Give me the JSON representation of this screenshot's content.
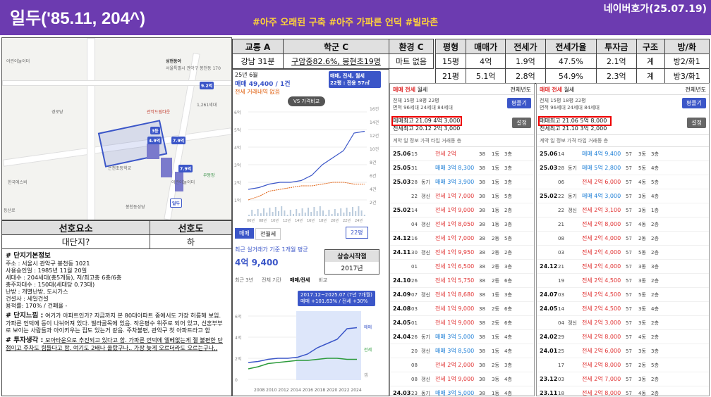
{
  "header": {
    "title": "일두('85.11, 204^)",
    "tags": "#아주 오래된 구축 #아주 가파른 언덕 #빌라촌",
    "source": "네이버호가(25.07.19)"
  },
  "summary_table": {
    "headers": [
      "교통 A",
      "학군 C",
      "환경 C"
    ],
    "values": [
      "강남 31분",
      "구암중82.6%, 봉현초19명",
      "마트 없음"
    ]
  },
  "type_table": {
    "headers": [
      "평형",
      "매매가",
      "전세가",
      "전세가율",
      "투자금",
      "구조",
      "방/화"
    ],
    "rows": [
      [
        "15평",
        "4억",
        "1.9억",
        "47.5%",
        "2.1억",
        "계",
        "방2/화1"
      ],
      [
        "21평",
        "5.1억",
        "2.8억",
        "54.9%",
        "2.3억",
        "계",
        "방3/화1"
      ]
    ]
  },
  "map": {
    "labels": [
      "어린이놀이터",
      "성현동아",
      "서울특별시 관악구 봉천동 170",
      "9.2억",
      "1,261세대",
      "관악드림타운",
      "3등",
      "8억",
      "4.9억",
      "7.9억",
      "5등",
      "7.9억",
      "은천초등학교",
      "어린이놀이터",
      "한국에스비",
      "우동장",
      "경로당",
      "봉천동성당",
      "어린이놀이터",
      "등산로",
      "일두"
    ]
  },
  "prefs": {
    "h1": "선호요소",
    "h2": "선호도",
    "v1": "대단지?",
    "v2": "하"
  },
  "memo": {
    "s1": "# 단지기본정보",
    "l1": "주소 : 서울시 관악구 봉천동 1021",
    "l2": "사용승인일 : 1985년 11월 20일",
    "l3": "세대수 : 204세대(총5개동), 저/최고층 6층/6층",
    "l4": "총주차대수 : 150대(세대당 0.73대)",
    "l5": "난방 : 개별난방, 도시가스",
    "l6": "건설사 : 세일건설",
    "l7": "용적률: 170% / 건폐율 -",
    "s2": "# 단지느낌 :",
    "p2": " 여기가 아파트인가? 지금까지 본 80대아파트 중에서도 가장 허름해 보임. 가파른 언덕에 동이 나뉘어져 있다. 빌라골목에 있음. 작은평수 위주로 되어 있고, 신혼부부로 보이는 사람들과 아이키우는 집도 있는거 같음. 주차불편, 관악구 첫 아파트라고 함",
    "s3": "# 투자생각 :",
    "p3": " 모아타운으로 추진되고 있다고 함. 가파른 언덕에 엘베없는게 젤 불편한 단점이고 주차도 힘들다고 함. 여기도 2배나 올랐구나.. 가장 늦게 오르더라도 오르는구나,,"
  },
  "chart": {
    "date": "25년 6월",
    "trade": "매매 49,400 / 1건",
    "rent": "전세 거래내역 없음",
    "vs": "VS 가격비교",
    "filter": "매매, 전세, 월세",
    "size": "22평 : 전용 57㎡",
    "yticks": [
      "6억",
      "5억",
      "4억",
      "3억",
      "2억",
      "1억"
    ],
    "yright": [
      "16건",
      "14건",
      "12건",
      "10건",
      "8건",
      "6건",
      "4건",
      "2건"
    ],
    "xticks": [
      "06년",
      "08년",
      "10년",
      "12년",
      "14년",
      "16년",
      "18년",
      "20년",
      "22년",
      "24년"
    ],
    "tab1": "매매",
    "tab2": "전월세",
    "sel": "22평",
    "recent": "최근 실거래가 기준 1개월 평균",
    "recentval": "4억 9,400",
    "risehead": "상승시작점",
    "riseyear": "2017년",
    "periods": [
      "최근 3년",
      "전체 기간",
      "매매/전세",
      "비교"
    ],
    "tooltip1": "2017.12~2025.07 (7년 7개월)",
    "tooltip2": "매매 +101.63% / 전세 +30%",
    "y2": [
      "6억",
      "4억",
      "2억",
      "0"
    ],
    "legend": [
      "매매",
      "전세",
      "갭"
    ],
    "x2": "2008 2010 2012 2014 2016 2018 2020 2022 2024",
    "chart_data": {
      "type": "line",
      "series": [
        {
          "name": "매매",
          "values": [
            1.6,
            1.7,
            1.9,
            2.0,
            2.0,
            2.1,
            2.4,
            3.0,
            3.4,
            3.8,
            4.8,
            4.9
          ]
        },
        {
          "name": "전세",
          "values": [
            1.0,
            1.2,
            1.5,
            1.6,
            1.7,
            1.8,
            1.8,
            1.9,
            2.0,
            2.0,
            1.9,
            1.9
          ]
        }
      ]
    }
  },
  "list1": {
    "tabs": [
      "매매",
      "전세",
      "월세"
    ],
    "year": "전체년도",
    "info": "전체 15평 18평 22평",
    "info2": "면적 96세대 24세대 84세대",
    "btn": "평플기",
    "max1": "매매최고 21.09 4억 3,000",
    "max2": "전세최고 20.12 2억 3,000",
    "set": "설정",
    "cols": "계약 일 정보 가격 타입 거래동 층",
    "rows": [
      [
        "25.06",
        "15",
        "",
        "전세 2억",
        "38",
        "1동",
        "3층"
      ],
      [
        "25.05",
        "31",
        "",
        "매매 3억 8,300",
        "38",
        "1동",
        "3층"
      ],
      [
        "25.03",
        "28",
        "동기",
        "매매 3억 3,900",
        "38",
        "1동",
        "3층"
      ],
      [
        "",
        "22",
        "갱신",
        "전세 1억 7,000",
        "38",
        "1동",
        "5층"
      ],
      [
        "25.02",
        "14",
        "",
        "전세 1억 9,000",
        "38",
        "1동",
        "2층"
      ],
      [
        "",
        "04",
        "갱신",
        "전세 1억 8,050",
        "38",
        "1동",
        "3층"
      ],
      [
        "24.12",
        "16",
        "",
        "전세 1억 7,000",
        "38",
        "2동",
        "5층"
      ],
      [
        "24.11",
        "30",
        "갱신",
        "전세 1억 9,950",
        "38",
        "2동",
        "2층"
      ],
      [
        "",
        "01",
        "",
        "전세 1억 6,500",
        "38",
        "2동",
        "3층"
      ],
      [
        "24.10",
        "26",
        "",
        "전세 1억 5,750",
        "38",
        "2동",
        "6층"
      ],
      [
        "24.09",
        "07",
        "갱신",
        "전세 1억 8,680",
        "38",
        "1동",
        "3층"
      ],
      [
        "24.08",
        "03",
        "",
        "전세 1억 9,000",
        "38",
        "2동",
        "6층"
      ],
      [
        "24.05",
        "01",
        "",
        "전세 1억 9,000",
        "38",
        "2동",
        "6층"
      ],
      [
        "24.04",
        "26",
        "동기",
        "매매 3억 5,000",
        "38",
        "1동",
        "4층"
      ],
      [
        "",
        "20",
        "갱신",
        "매매 3억 8,500",
        "38",
        "1동",
        "4층"
      ],
      [
        "",
        "08",
        "",
        "전세 2억 2,000",
        "38",
        "2동",
        "3층"
      ],
      [
        "",
        "08",
        "갱신",
        "전세 1억 9,000",
        "38",
        "3동",
        "4층"
      ],
      [
        "24.03",
        "23",
        "동기",
        "매매 3억 5,000",
        "38",
        "1동",
        "4층"
      ]
    ]
  },
  "list2": {
    "tabs": [
      "매매",
      "전세",
      "월세"
    ],
    "year": "전체년도",
    "info": "전체 15평 18평 22평",
    "info2": "면적 96세대 24세대 84세대",
    "btn": "평플기",
    "max1": "매매최고 21.06 5억 8,000",
    "max2": "전세최고 21.10 3억 2,000",
    "set": "설정",
    "cols": "계약 일 정보 가격 타입 거래동 층",
    "rows": [
      [
        "25.06",
        "14",
        "",
        "매매 4억 9,400",
        "57",
        "3동",
        "3층"
      ],
      [
        "25.03",
        "28",
        "동기",
        "매매 5억 2,800",
        "57",
        "5동",
        "4층"
      ],
      [
        "",
        "06",
        "",
        "전세 2억 6,000",
        "57",
        "4동",
        "5층"
      ],
      [
        "25.02",
        "22",
        "동기",
        "매매 4억 3,000",
        "57",
        "3동",
        "4층"
      ],
      [
        "",
        "22",
        "갱신",
        "전세 2억 3,100",
        "57",
        "3동",
        "1층"
      ],
      [
        "",
        "21",
        "",
        "전세 2억 8,000",
        "57",
        "4동",
        "2층"
      ],
      [
        "",
        "08",
        "",
        "전세 2억 4,000",
        "57",
        "2동",
        "2층"
      ],
      [
        "",
        "03",
        "",
        "전세 2억 4,000",
        "57",
        "5동",
        "2층"
      ],
      [
        "24.12",
        "21",
        "",
        "전세 2억 4,000",
        "57",
        "3동",
        "3층"
      ],
      [
        "",
        "19",
        "",
        "전세 2억 4,500",
        "57",
        "3동",
        "2층"
      ],
      [
        "24.07",
        "03",
        "",
        "전세 2억 4,500",
        "57",
        "5동",
        "2층"
      ],
      [
        "24.05",
        "14",
        "",
        "전세 2억 4,500",
        "57",
        "3동",
        "4층"
      ],
      [
        "",
        "04",
        "갱신",
        "전세 2억 3,000",
        "57",
        "3동",
        "2층"
      ],
      [
        "24.02",
        "29",
        "",
        "전세 2억 8,000",
        "57",
        "4동",
        "2층"
      ],
      [
        "24.01",
        "25",
        "",
        "전세 2억 6,000",
        "57",
        "3동",
        "3층"
      ],
      [
        "",
        "17",
        "",
        "전세 2억 8,000",
        "57",
        "2동",
        "5층"
      ],
      [
        "23.12",
        "03",
        "",
        "전세 2억 7,000",
        "57",
        "3동",
        "2층"
      ],
      [
        "23.11",
        "18",
        "",
        "전세 2억 8,000",
        "57",
        "4동",
        "2층"
      ]
    ]
  }
}
